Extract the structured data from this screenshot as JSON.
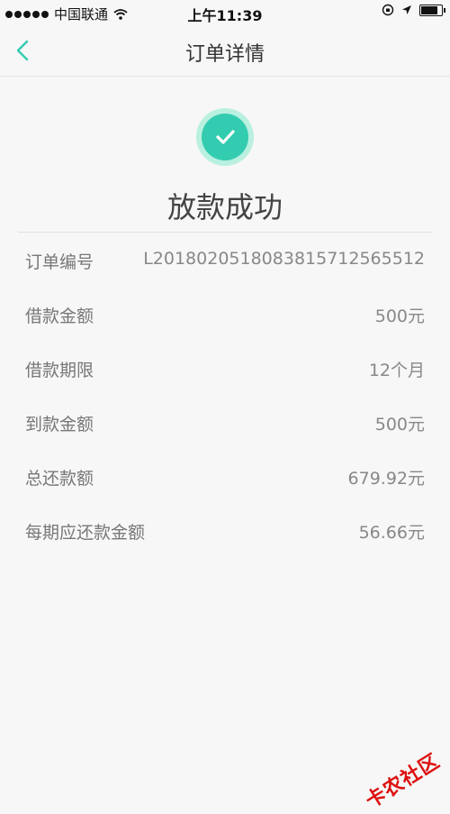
{
  "status_bar": {
    "carrier": "中国联通",
    "time": "上午11:39"
  },
  "nav": {
    "title": "订单详情"
  },
  "result": {
    "text": "放款成功",
    "icon": "check-icon",
    "accent": "#33ccb0"
  },
  "details": [
    {
      "label": "订单编号",
      "value": "L2018020518083815712565512"
    },
    {
      "label": "借款金额",
      "value": "500元"
    },
    {
      "label": "借款期限",
      "value": "12个月"
    },
    {
      "label": "到款金额",
      "value": "500元"
    },
    {
      "label": "总还款额",
      "value": "679.92元"
    },
    {
      "label": "每期应还款金额",
      "value": "56.66元"
    }
  ],
  "watermark": "卡农社区"
}
